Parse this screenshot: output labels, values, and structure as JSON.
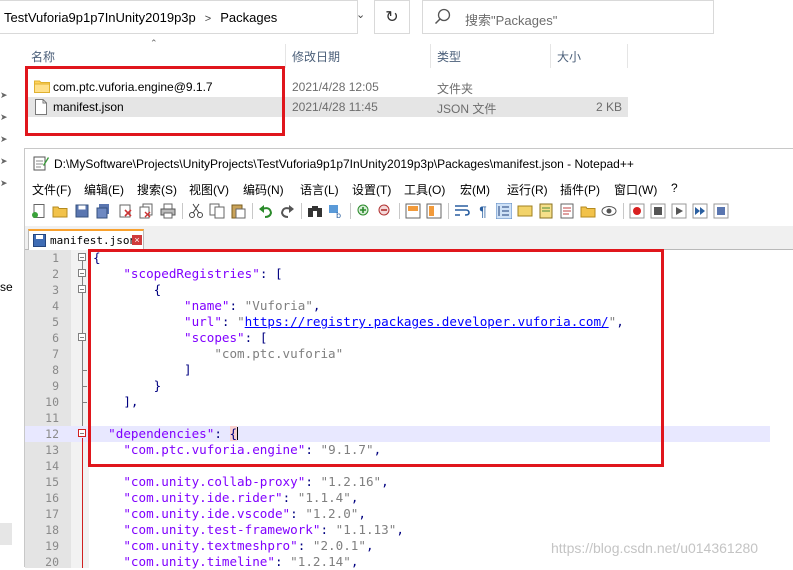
{
  "explorer": {
    "breadcrumb": [
      "TestVuforia9p1p7InUnity2019p3p",
      "Packages"
    ],
    "search_placeholder": "搜索\"Packages\"",
    "columns": {
      "name": "名称",
      "date": "修改日期",
      "type": "类型",
      "size": "大小"
    },
    "files": [
      {
        "name": "com.ptc.vuforia.engine@9.1.7",
        "date": "2021/4/28 12:05",
        "type": "文件夹",
        "size": "",
        "icon": "folder-icon",
        "selected": false
      },
      {
        "name": "manifest.json",
        "date": "2021/4/28 11:45",
        "type": "JSON 文件",
        "size": "2 KB",
        "icon": "file-icon",
        "selected": true
      }
    ],
    "sidebar_partial_text": "se"
  },
  "notepad": {
    "title": "D:\\MySoftware\\Projects\\UnityProjects\\TestVuforia9p1p7InUnity2019p3p\\Packages\\manifest.json - Notepad++",
    "menu": [
      "文件(F)",
      "编辑(E)",
      "搜索(S)",
      "视图(V)",
      "编码(N)",
      "语言(L)",
      "设置(T)",
      "工具(O)",
      "宏(M)",
      "运行(R)",
      "插件(P)",
      "窗口(W)",
      "?"
    ],
    "tab_label": "manifest.json",
    "lines": [
      {
        "n": "1",
        "text": "{"
      },
      {
        "n": "2",
        "text": "    \"scopedRegistries\": ["
      },
      {
        "n": "3",
        "text": "        {"
      },
      {
        "n": "4",
        "text": "            \"name\": \"Vuforia\","
      },
      {
        "n": "5",
        "text": "            \"url\": \"https://registry.packages.developer.vuforia.com/\","
      },
      {
        "n": "6",
        "text": "            \"scopes\": ["
      },
      {
        "n": "7",
        "text": "                \"com.ptc.vuforia\""
      },
      {
        "n": "8",
        "text": "            ]"
      },
      {
        "n": "9",
        "text": "        }"
      },
      {
        "n": "10",
        "text": "    ],"
      },
      {
        "n": "11",
        "text": ""
      },
      {
        "n": "12",
        "text": "  \"dependencies\": {"
      },
      {
        "n": "13",
        "text": "    \"com.ptc.vuforia.engine\": \"9.1.7\","
      },
      {
        "n": "14",
        "text": ""
      },
      {
        "n": "15",
        "text": "    \"com.unity.collab-proxy\": \"1.2.16\","
      },
      {
        "n": "16",
        "text": "    \"com.unity.ide.rider\": \"1.1.4\","
      },
      {
        "n": "17",
        "text": "    \"com.unity.ide.vscode\": \"1.2.0\","
      },
      {
        "n": "18",
        "text": "    \"com.unity.test-framework\": \"1.1.13\","
      },
      {
        "n": "19",
        "text": "    \"com.unity.textmeshpro\": \"2.0.1\","
      },
      {
        "n": "20",
        "text": "    \"com.unity.timeline\": \"1.2.14\","
      }
    ]
  },
  "watermark": "https://blog.csdn.net/u014361280",
  "colors": {
    "highlight_box": "#e0161c",
    "json_key": "#8000ff",
    "json_string": "#808080",
    "url": "#0000ff",
    "current_line": "#e8e8ff"
  }
}
